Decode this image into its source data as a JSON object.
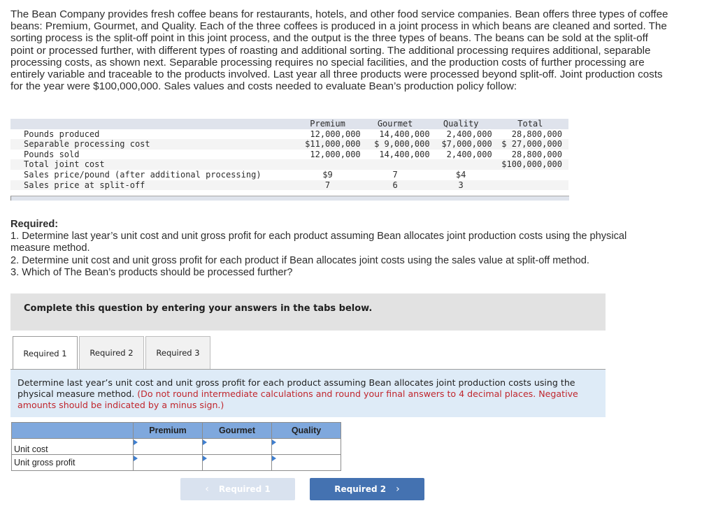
{
  "intro_text": "The Bean Company provides fresh coffee beans for restaurants, hotels, and other food service companies. Bean offers three types of coffee beans: Premium, Gourmet, and Quality. Each of the three coffees is produced in a joint process in which beans are cleaned and sorted. The sorting process is the split-off point in this joint process, and the output is the three types of beans. The beans can be sold at the split-off point or processed further, with different types of roasting and additional sorting. The additional processing requires additional, separable processing costs, as shown next. Separable processing requires no special facilities, and the production costs of further processing are entirely variable and traceable to the products involved. Last year all three products were processed beyond split-off. Joint production costs for the year were $100,000,000. Sales values and costs needed to evaluate Bean’s production policy follow:",
  "data_table": {
    "headers": [
      "",
      "Premium",
      "Gourmet",
      "Quality",
      "Total"
    ],
    "rows": [
      {
        "label": "Pounds produced",
        "premium": "12,000,000",
        "gourmet": "14,400,000",
        "quality": "2,400,000",
        "total": "28,800,000"
      },
      {
        "label": "Separable processing cost",
        "premium": "$11,000,000",
        "gourmet": "$ 9,000,000",
        "quality": "$7,000,000",
        "total": "$ 27,000,000"
      },
      {
        "label": "Pounds sold",
        "premium": "12,000,000",
        "gourmet": "14,400,000",
        "quality": "2,400,000",
        "total": "28,800,000"
      },
      {
        "label": "Total joint cost",
        "premium": "",
        "gourmet": "",
        "quality": "",
        "total": "$100,000,000"
      },
      {
        "label": "Sales price/pound (after additional processing)",
        "premium": "$9",
        "gourmet": "7",
        "quality": "$4",
        "total": ""
      },
      {
        "label": "Sales price at split-off",
        "premium": "7",
        "gourmet": "6",
        "quality": "3",
        "total": ""
      }
    ]
  },
  "required": {
    "title": "Required:",
    "items": [
      "1. Determine last year’s unit cost and unit gross profit for each product assuming Bean allocates joint production costs using the physical measure method.",
      "2. Determine unit cost and unit gross profit for each product if Bean allocates joint costs using the sales value at split-off method.",
      "3. Which of The Bean’s products should be processed further?"
    ]
  },
  "instruction_banner": "Complete this question by entering your answers in the tabs below.",
  "tabs": [
    {
      "label": "Required 1",
      "active": true
    },
    {
      "label": "Required 2",
      "active": false
    },
    {
      "label": "Required 3",
      "active": false
    }
  ],
  "panel": {
    "text": "Determine last year’s unit cost and unit gross profit for each product assuming Bean allocates joint production costs using the physical measure method.",
    "note": "(Do not round intermediate calculations and round your final answers to 4 decimal places. Negative amounts should be indicated by a minus sign.)"
  },
  "answer_table": {
    "headers": [
      "",
      "Premium",
      "Gourmet",
      "Quality"
    ],
    "rows": [
      {
        "label": "Unit cost",
        "values": [
          "",
          "",
          ""
        ]
      },
      {
        "label": "Unit gross profit",
        "values": [
          "",
          "",
          ""
        ]
      }
    ]
  },
  "nav": {
    "prev_label": "Required 1",
    "next_label": "Required 2",
    "prev_icon": "‹",
    "next_icon": "›"
  },
  "colors": {
    "accent_blue": "#4472b1",
    "header_blue": "#7fa8dd",
    "panel_blue": "#deebf7",
    "note_red": "#c0262d"
  }
}
